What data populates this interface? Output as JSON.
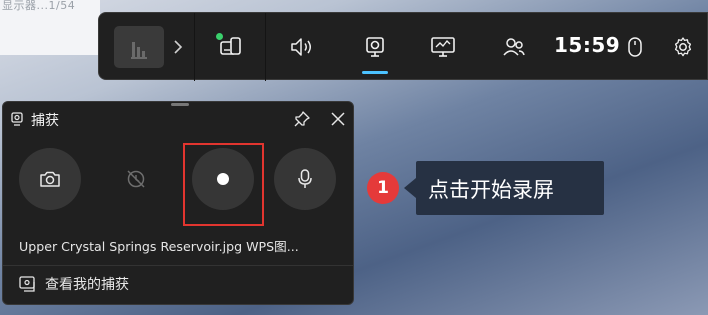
{
  "background": {
    "partial_text": "显示器...1/54"
  },
  "gamebar": {
    "time": "15:59",
    "buttons": [
      {
        "name": "app-context-icon"
      },
      {
        "name": "chevron-right-icon"
      },
      {
        "name": "widget-menu-icon"
      },
      {
        "name": "audio-icon"
      },
      {
        "name": "capture-icon",
        "active": true
      },
      {
        "name": "performance-icon"
      },
      {
        "name": "xbox-social-icon"
      },
      {
        "name": "mouse-icon"
      },
      {
        "name": "settings-icon"
      }
    ],
    "accent_color": "#4cc2ff",
    "widget_status_color": "#3ad06c"
  },
  "capture": {
    "title": "捕获",
    "file_label": "Upper Crystal Springs Reservoir.jpg  WPS图...",
    "gallery_label": "查看我的捕获",
    "buttons": [
      {
        "name": "screenshot-button",
        "icon": "camera-icon"
      },
      {
        "name": "record-last-30s-button",
        "icon": "record-history-icon",
        "disabled": true
      },
      {
        "name": "start-recording-button",
        "icon": "record-dot-icon",
        "highlighted": true
      },
      {
        "name": "microphone-button",
        "icon": "microphone-icon"
      }
    ],
    "highlight_color": "#e2352f"
  },
  "callout": {
    "step": "1",
    "text": "点击开始录屏",
    "badge_color": "#e53a3a"
  }
}
